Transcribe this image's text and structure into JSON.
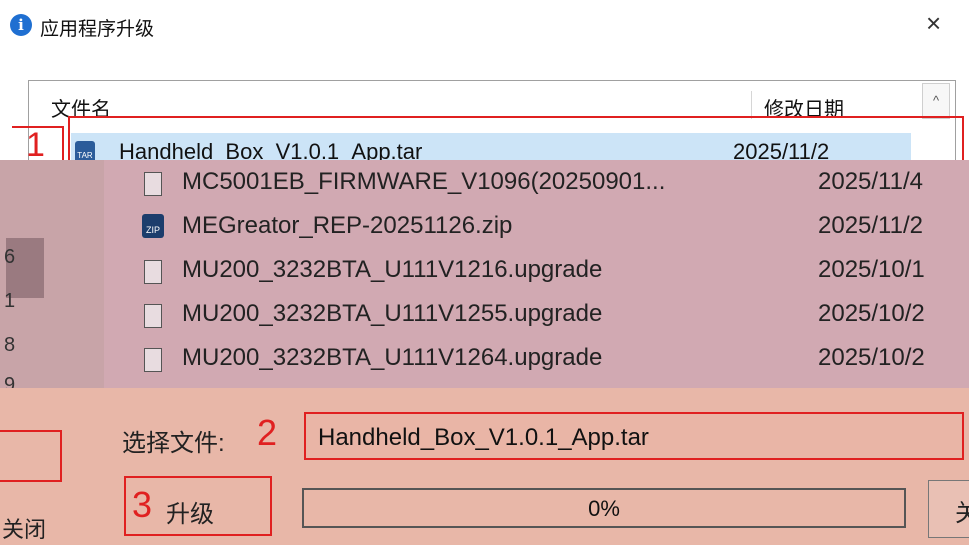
{
  "window": {
    "title": "应用程序升级",
    "close_glyph": "×",
    "info_icon": "info-icon"
  },
  "list": {
    "col_name": "文件名",
    "col_date": "修改日期",
    "scroll_up": "^",
    "selected": {
      "name": "Handheld_Box_V1.0.1_App.tar",
      "date": "2025/11/2",
      "icon_label": "TAR"
    }
  },
  "files": [
    {
      "name": "MC5001EB_FIRMWARE_V1096(20250901...",
      "date": "2025/11/4",
      "icon": "file-icon"
    },
    {
      "name": "MEGreator_REP-20251126.zip",
      "date": "2025/11/2",
      "icon": "zip-icon",
      "icon_label": "ZIP"
    },
    {
      "name": "MU200_3232BTA_U111V1216.upgrade",
      "date": "2025/10/1",
      "icon": "file-icon"
    },
    {
      "name": "MU200_3232BTA_U111V1255.upgrade",
      "date": "2025/10/2",
      "icon": "file-icon"
    },
    {
      "name": "MU200_3232BTA_U111V1264.upgrade",
      "date": "2025/10/2",
      "icon": "file-icon"
    }
  ],
  "left_strip": [
    "6",
    "1",
    "8",
    "9"
  ],
  "form": {
    "select_label": "选择文件:",
    "selected_file": "Handheld_Box_V1.0.1_App.tar",
    "upgrade_label": "升级",
    "progress_text": "0%",
    "progress_value": 0,
    "left_close_label": "关闭",
    "right_button_label": "关"
  },
  "markers": {
    "m1": "1",
    "m2": "2",
    "m3": "3"
  },
  "colors": {
    "marker_red": "#e02020",
    "selection_blue": "#cce4f7",
    "overlay_pink": "#c8a4a8"
  }
}
